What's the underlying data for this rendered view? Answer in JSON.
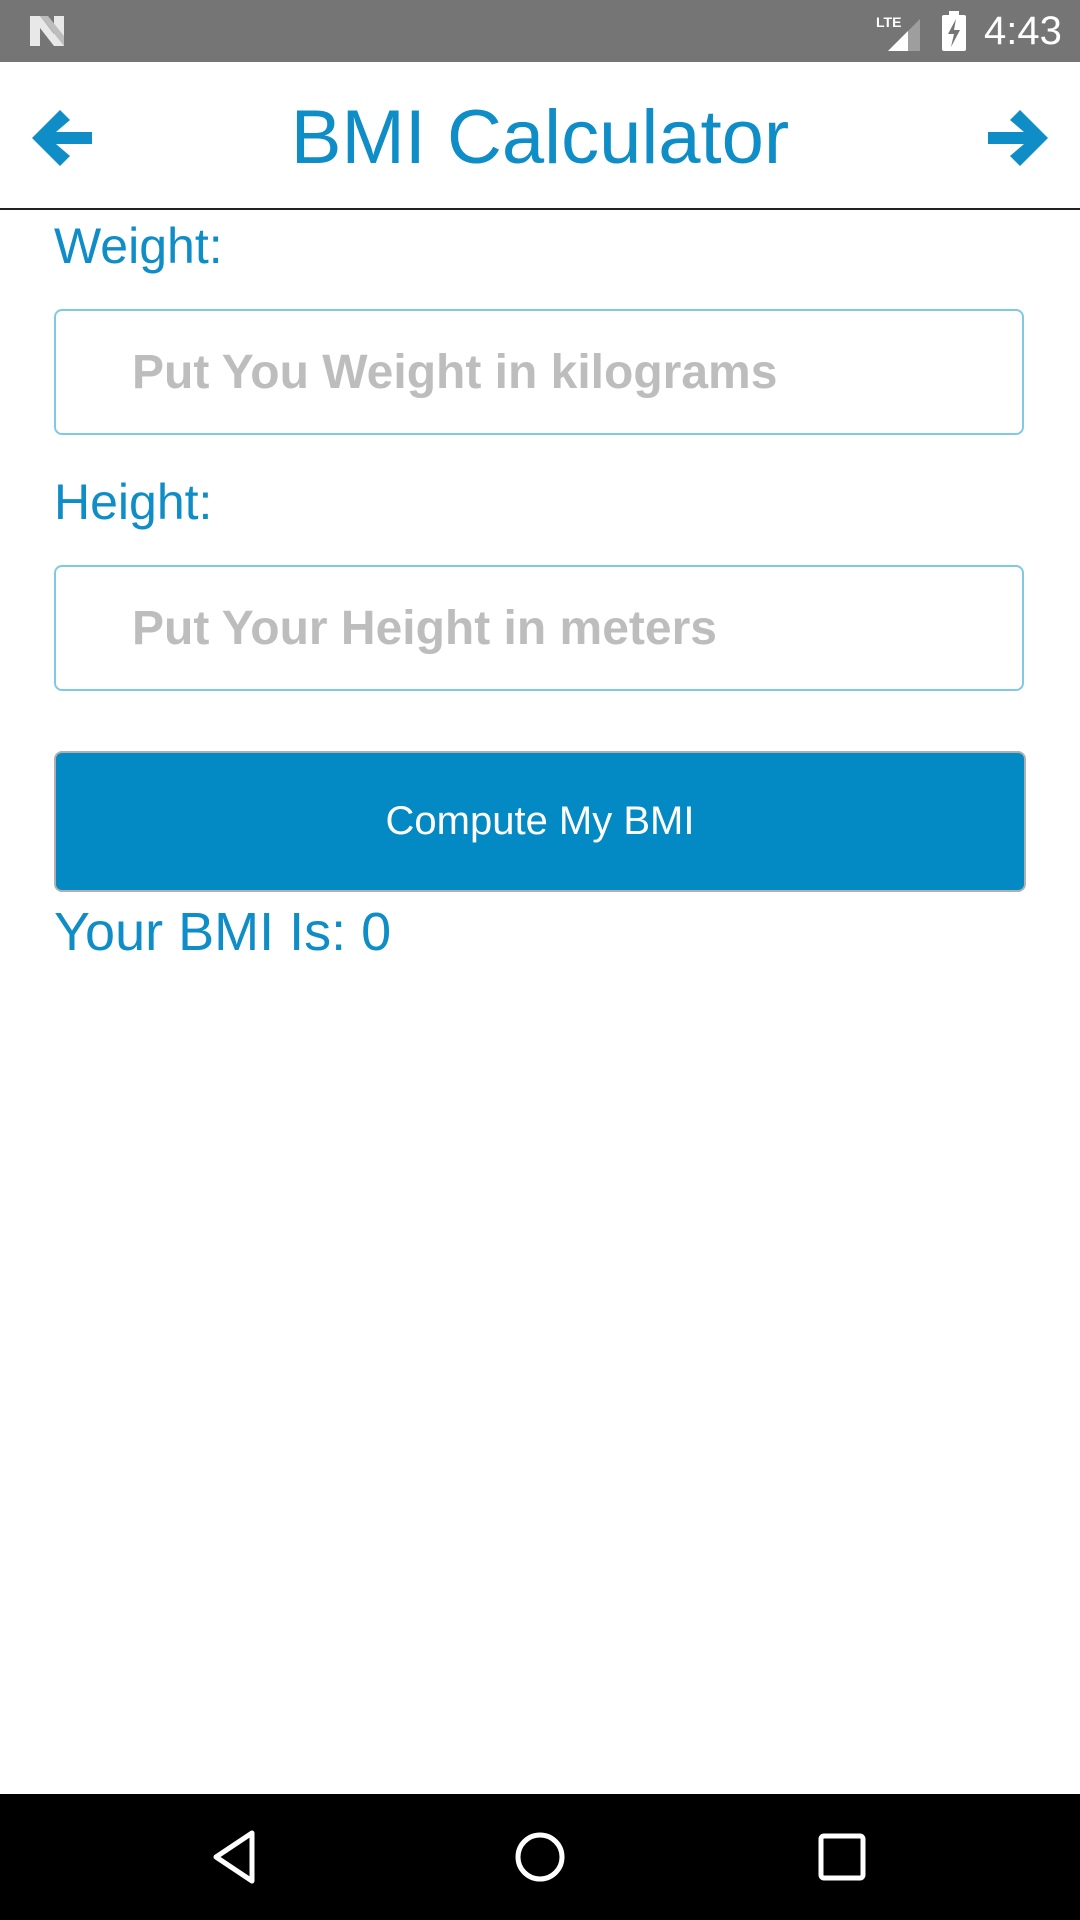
{
  "status_bar": {
    "time": "4:43",
    "network": "LTE",
    "icons": [
      "n-logo-icon",
      "lte-signal-icon",
      "battery-charging-icon"
    ]
  },
  "header": {
    "title": "BMI Calculator",
    "back_icon": "arrow-left-icon",
    "forward_icon": "arrow-right-icon"
  },
  "form": {
    "weight_label": "Weight:",
    "weight_placeholder": "Put You Weight in kilograms",
    "weight_value": "",
    "height_label": "Height:",
    "height_placeholder": "Put Your Height in meters",
    "height_value": "",
    "compute_label": "Compute My BMI",
    "result_text": "Your BMI Is: 0"
  },
  "navigation_bar": {
    "icons": [
      "back-triangle-icon",
      "home-circle-icon",
      "recents-square-icon"
    ]
  },
  "colors": {
    "accent": "#0f8dc7",
    "button": "#0389c3",
    "status_bar": "#757575",
    "placeholder": "#bdbdbd",
    "input_border": "#7fc9e6"
  }
}
